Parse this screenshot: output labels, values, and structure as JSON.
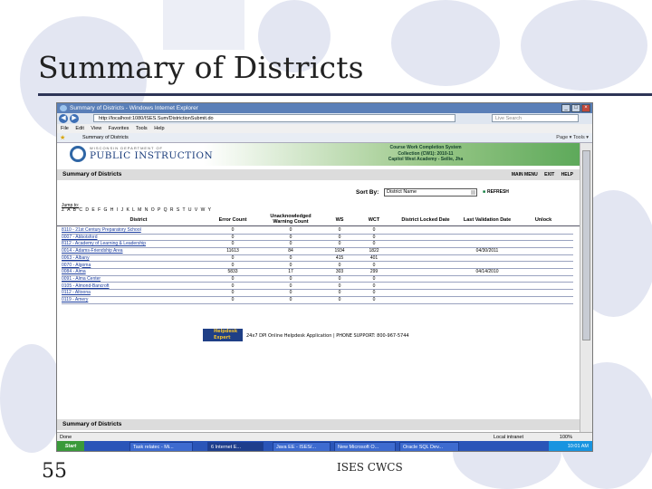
{
  "slide": {
    "title": "Summary of Districts",
    "number": "55",
    "footer": "ISES CWCS"
  },
  "browser": {
    "window_title": "Summary of Districts - Windows Internet Explorer",
    "url": "http://localhost:1080/ISES.Sum/DistrictionSubmit.do",
    "search_placeholder": "Live Search",
    "menu": [
      "File",
      "Edit",
      "View",
      "Favorites",
      "Tools",
      "Help"
    ],
    "tab_title": "Summary of Districts",
    "command_bar": "Page ▾   Tools ▾",
    "status": "Done",
    "zone": "Local intranet",
    "zoom": "100%"
  },
  "page": {
    "logo_top": "WISCONSIN DEPARTMENT OF",
    "logo_main": "PUBLIC INSTRUCTION",
    "banner_lines": [
      "Course Work Completion System",
      "Collection (CW1): 2010-11",
      "Capitol West Academy - Seilie, Jha"
    ],
    "header": "Summary of Districts",
    "header_links": [
      "MAIN MENU",
      "EXIT",
      "HELP"
    ],
    "sort_label": "Sort By:",
    "sort_value": "District Name",
    "refresh_label": "REFRESH",
    "jump_label": "Jump to:",
    "letters": "Z A B C D E F G H I J K L M N O P Q R S T U V W Y",
    "columns": [
      "District",
      "Error Count",
      "Unacknowledged Warning Count",
      "WS",
      "WCT",
      "District Locked Date",
      "Last Validation Date",
      "Unlock"
    ],
    "footer_header": "Summary of Districts",
    "helpdesk_logo": "Helpdesk Expert",
    "helpdesk_text": "24x7 DPI Online Helpdesk Application | PHONE SUPPORT: 800-967-5744"
  },
  "rows": [
    {
      "district": "8110 - 21st Century Preparatory School",
      "err": "0",
      "warn": "0",
      "ws": "0",
      "wct": "0",
      "locked": "",
      "validated": ""
    },
    {
      "district": "0007 - Abbotsford",
      "err": "0",
      "warn": "0",
      "ws": "0",
      "wct": "0",
      "locked": "",
      "validated": ""
    },
    {
      "district": "8112 - Academy of Learning & Leadership",
      "err": "0",
      "warn": "0",
      "ws": "0",
      "wct": "0",
      "locked": "",
      "validated": ""
    },
    {
      "district": "0014 - Adams-Friendship Area",
      "err": "11613",
      "warn": "84",
      "ws": "1934",
      "wct": "1822",
      "locked": "",
      "validated": "04/30/2011"
    },
    {
      "district": "0063 - Albany",
      "err": "0",
      "warn": "0",
      "ws": "415",
      "wct": "401",
      "locked": "",
      "validated": ""
    },
    {
      "district": "0070 - Algoma",
      "err": "0",
      "warn": "0",
      "ws": "0",
      "wct": "0",
      "locked": "",
      "validated": ""
    },
    {
      "district": "0084 - Alma",
      "err": "5833",
      "warn": "17",
      "ws": "303",
      "wct": "299",
      "locked": "",
      "validated": "04/14/2010"
    },
    {
      "district": "0091 - Alma Center",
      "err": "0",
      "warn": "0",
      "ws": "0",
      "wct": "0",
      "locked": "",
      "validated": ""
    },
    {
      "district": "0105 - Almond-Bancroft",
      "err": "0",
      "warn": "0",
      "ws": "0",
      "wct": "0",
      "locked": "",
      "validated": ""
    },
    {
      "district": "0112 - Altoona",
      "err": "0",
      "warn": "0",
      "ws": "0",
      "wct": "0",
      "locked": "",
      "validated": ""
    },
    {
      "district": "0119 - Amery",
      "err": "0",
      "warn": "0",
      "ws": "0",
      "wct": "0",
      "locked": "",
      "validated": ""
    }
  ],
  "taskbar": {
    "start": "Start",
    "tasks": [
      "Task relatec - Mi...",
      "6 Internet E...",
      "Java EE - ISES/...",
      "New Microsoft O...",
      "Oracle SQL Dev..."
    ],
    "clock": "10:01 AM"
  }
}
